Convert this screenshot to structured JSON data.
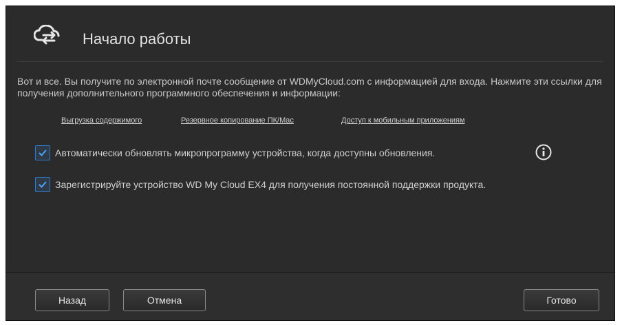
{
  "dialog": {
    "title": "Начало работы",
    "icon": "cloud-sync-icon",
    "paragraph": "Вот и все. Вы получите по электронной почте сообщение от WDMyCloud.com с информацией для входа. Нажмите эти ссылки для получения дополнительного программного обеспечения и информации:",
    "links": [
      "Выгрузка содержимого",
      "Резервное копирование ПК/Mac",
      "Доступ к мобильным приложениям"
    ],
    "checkboxes": [
      {
        "label": "Автоматически обновлять микропрограмму устройства, когда доступны обновления.",
        "checked": true
      },
      {
        "label": "Зарегистрируйте устройство WD My Cloud EX4 для получения постоянной поддержки продукта.",
        "checked": true
      }
    ],
    "buttons": {
      "back": "Назад",
      "cancel": "Отмена",
      "done": "Готово"
    }
  },
  "colors": {
    "background": "#2b2b2b",
    "checkbox_border": "#2f7ac9",
    "text": "#cfcfcf"
  }
}
